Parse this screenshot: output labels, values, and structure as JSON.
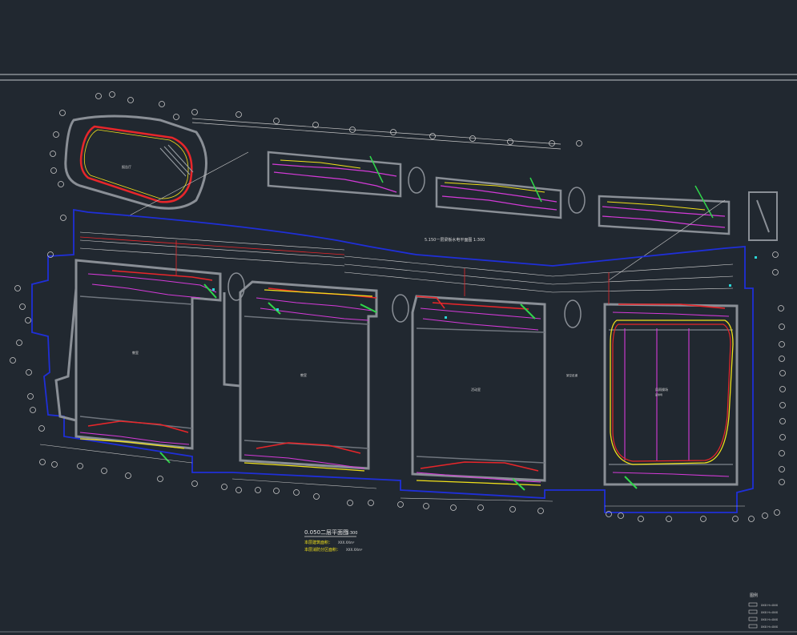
{
  "drawing": {
    "upper_floor_title": "5.150一层梁板水电平面图 1:300",
    "lower_floor_title": "0.050二层平面图",
    "lower_floor_scale": "1:300",
    "note_line_1": "本层建筑面积：",
    "note_line_1_value": "XXX.XXm²",
    "note_line_2": "本层消防分区面积：",
    "note_line_2_value": "XXX.XXm²",
    "oval_room_label": "报告厅",
    "hall_label_1": "教室",
    "hall_label_2": "教室",
    "hall_label_3": "活动室",
    "gym_label": "风雨操场",
    "gym_sub_label": "篮球场",
    "corridor_label": "架空走道",
    "legend_title": "图例",
    "legend_items": [
      "XXX H=XXX",
      "XXX H=XXX",
      "XXX H=XXX",
      "XXX H=XXX"
    ]
  },
  "colors": {
    "background": "#212830",
    "wall": "#8a8f96",
    "wall_dark": "#6f757d",
    "blue_boundary": "#1f2fd8",
    "red_line": "#e8262a",
    "magenta_line": "#d43ad8",
    "yellow_line": "#f1e11a",
    "green_mark": "#2fd64a",
    "cyan_mark": "#2ad6d6",
    "dim_line": "#c8c8c8"
  }
}
